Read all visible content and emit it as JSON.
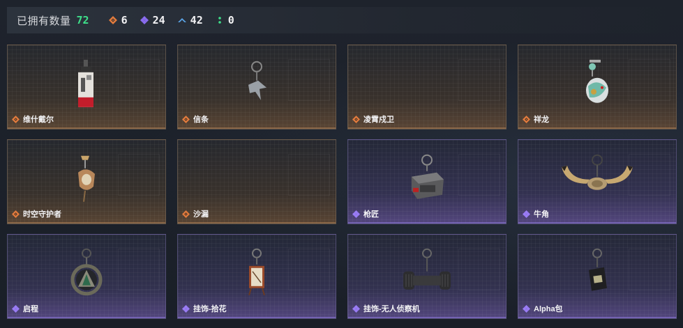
{
  "header": {
    "owned_label": "已拥有数量",
    "owned_count": "72",
    "stats": [
      {
        "icon": "orange-diamond-icon",
        "color": "#e27b3d",
        "value": "6"
      },
      {
        "icon": "purple-diamond-icon",
        "color": "#8a6cf0",
        "value": "24"
      },
      {
        "icon": "blue-chevron-icon",
        "color": "#5aa4e6",
        "value": "42"
      },
      {
        "icon": "green-dots-icon",
        "color": "#3ee08a",
        "value": "0"
      }
    ]
  },
  "items": [
    {
      "name": "维什戴尔",
      "rarity": "orange",
      "art": "tag-charm"
    },
    {
      "name": "信条",
      "rarity": "orange",
      "art": "bird-charm"
    },
    {
      "name": "凌霄戍卫",
      "rarity": "orange",
      "art": "empty"
    },
    {
      "name": "祥龙",
      "rarity": "orange",
      "art": "dragon-charm"
    },
    {
      "name": "时空守护者",
      "rarity": "orange",
      "art": "guardian-charm"
    },
    {
      "name": "沙漏",
      "rarity": "orange",
      "art": "empty"
    },
    {
      "name": "枪匠",
      "rarity": "purple",
      "art": "box-charm"
    },
    {
      "name": "牛角",
      "rarity": "purple",
      "art": "horn-charm"
    },
    {
      "name": "启程",
      "rarity": "purple",
      "art": "ring-charm"
    },
    {
      "name": "挂饰-拾花",
      "rarity": "purple",
      "art": "sign-charm"
    },
    {
      "name": "挂饰-无人侦察机",
      "rarity": "purple",
      "art": "drone-charm"
    },
    {
      "name": "Alpha包",
      "rarity": "purple",
      "art": "bag-charm"
    }
  ]
}
